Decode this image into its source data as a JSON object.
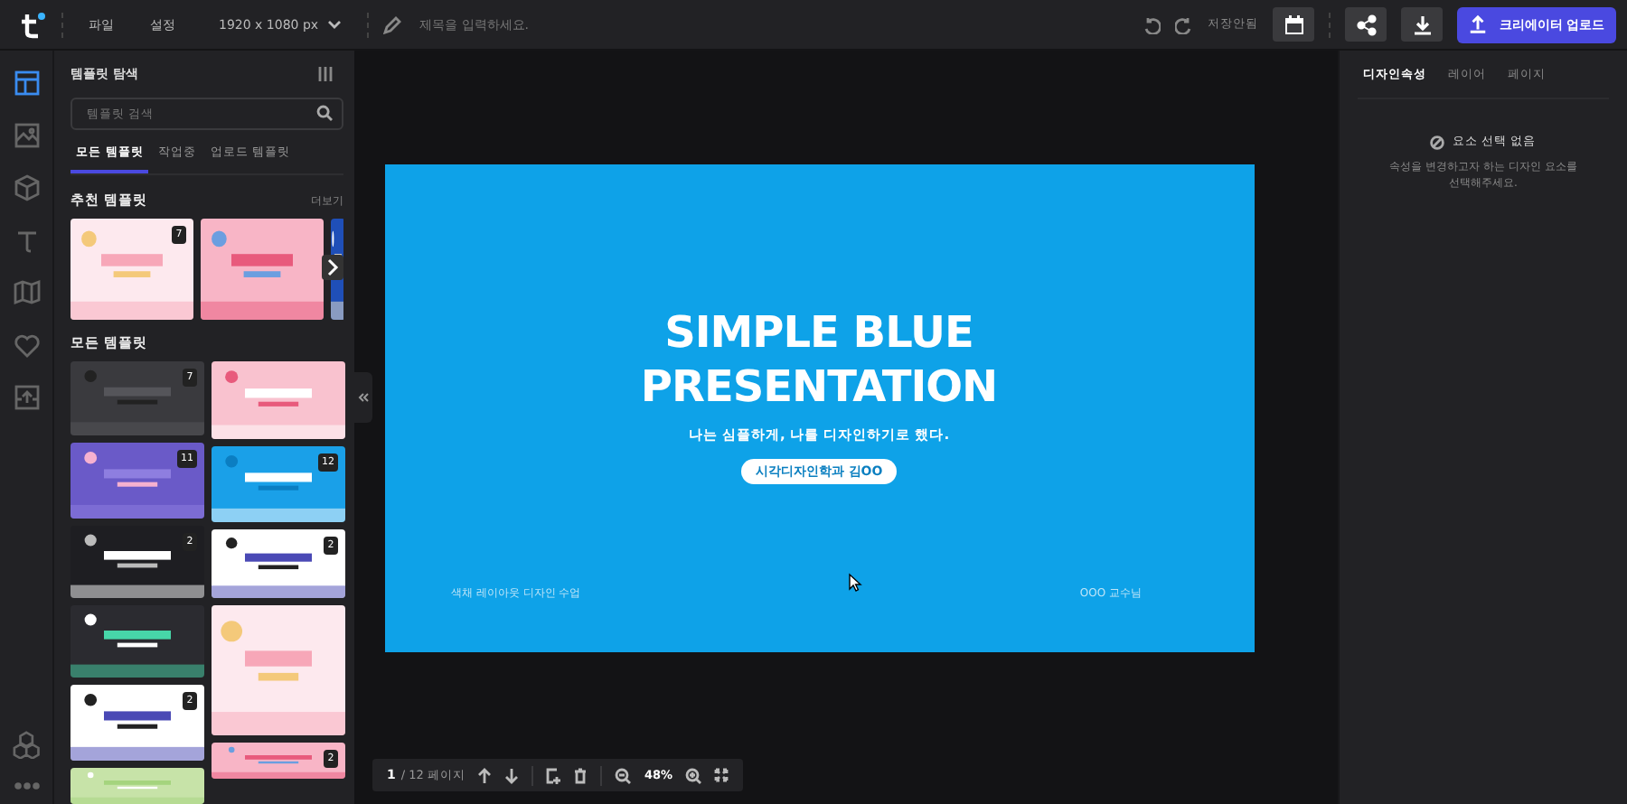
{
  "topbar": {
    "menus": [
      "파일",
      "설정"
    ],
    "size": "1920 x 1080 px",
    "title_placeholder": "제목을 입력하세요.",
    "save_status": "저장안됨",
    "upload_button": "크리에이터 업로드"
  },
  "rail": [
    {
      "selected": true
    },
    {
      "selected": false
    },
    {
      "selected": false
    },
    {
      "selected": false
    },
    {
      "selected": false
    },
    {
      "selected": false
    },
    {
      "selected": false
    }
  ],
  "panel": {
    "title": "템플릿 탐색",
    "search_placeholder": "템플릿 검색",
    "tabs": [
      {
        "label": "모든 템플릿",
        "selected": true
      },
      {
        "label": "작업중",
        "selected": false
      },
      {
        "label": "업로드 템플릿",
        "selected": false
      }
    ],
    "recommended": {
      "title": "추천 템플릿",
      "more": "더보기",
      "cards": [
        {
          "kind": "picture",
          "badge": "7"
        },
        {
          "kind": "picture"
        },
        {
          "kind": "picture"
        }
      ]
    },
    "all_title": "모든 템플릿",
    "columns": [
      [
        {
          "kind": "picture",
          "badge": "7"
        },
        {
          "kind": "picture",
          "badge": "11"
        },
        {
          "kind": "picture",
          "badge": "2"
        },
        {
          "kind": "picture"
        },
        {
          "kind": "picture",
          "badge": "2"
        },
        {
          "kind": "picture"
        }
      ],
      [
        {
          "kind": "picture"
        },
        {
          "kind": "picture",
          "badge": "12"
        },
        {
          "kind": "picture",
          "badge": "2"
        },
        {
          "kind": "picture"
        },
        {
          "kind": "picture",
          "badge": "2"
        }
      ]
    ]
  },
  "slide": {
    "title": "SIMPLE BLUE\nPRESENTATION",
    "subtitle": "나는 심플하게, 나를 디자인하기로 했다.",
    "pill": "시각디자인학과 김OO",
    "footer_left": "색채 레이아웃 디자인 수업",
    "footer_right": "OOO 교수님"
  },
  "pager": {
    "current": "1",
    "total": "/ 12 페이지",
    "zoom": "48%"
  },
  "props": {
    "tabs": [
      {
        "label": "디자인속성",
        "selected": true
      },
      {
        "label": "레이어",
        "selected": false
      },
      {
        "label": "페이지",
        "selected": false
      }
    ],
    "empty_title": "요소 선택 없음",
    "empty_text": "속성을 변경하고자 하는 디자인 요소를\n선택해주세요."
  }
}
